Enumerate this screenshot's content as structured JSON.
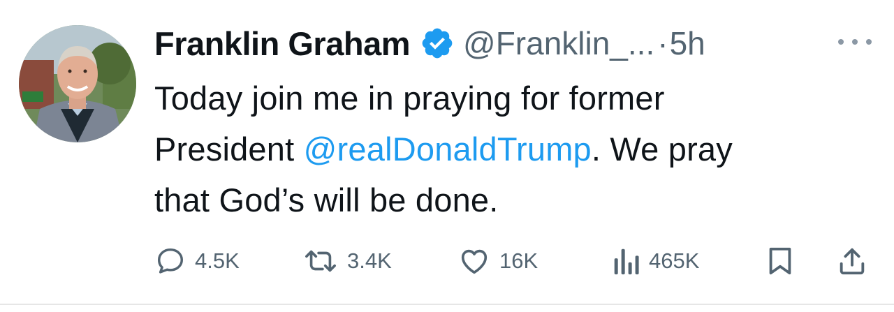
{
  "author": {
    "display_name": "Franklin Graham",
    "handle": "@Franklin_...",
    "separator": "·",
    "time": "5h",
    "verified_color": "#1d9bf0"
  },
  "tweet": {
    "line1": "Today join me in praying for former",
    "line2_prefix": "President ",
    "mention": "@realDonaldTrump",
    "line2_suffix": ". We pray",
    "line3": "that God’s will be done."
  },
  "actions": {
    "replies": "4.5K",
    "retweets": "3.4K",
    "likes": "16K",
    "views": "465K"
  },
  "icons": {
    "reply": "reply-icon",
    "retweet": "retweet-icon",
    "like": "heart-icon",
    "views": "views-icon",
    "bookmark": "bookmark-icon",
    "share": "share-icon",
    "more": "more-icon"
  },
  "colors": {
    "text": "#0f1419",
    "secondary": "#536471",
    "accent": "#1d9bf0"
  }
}
